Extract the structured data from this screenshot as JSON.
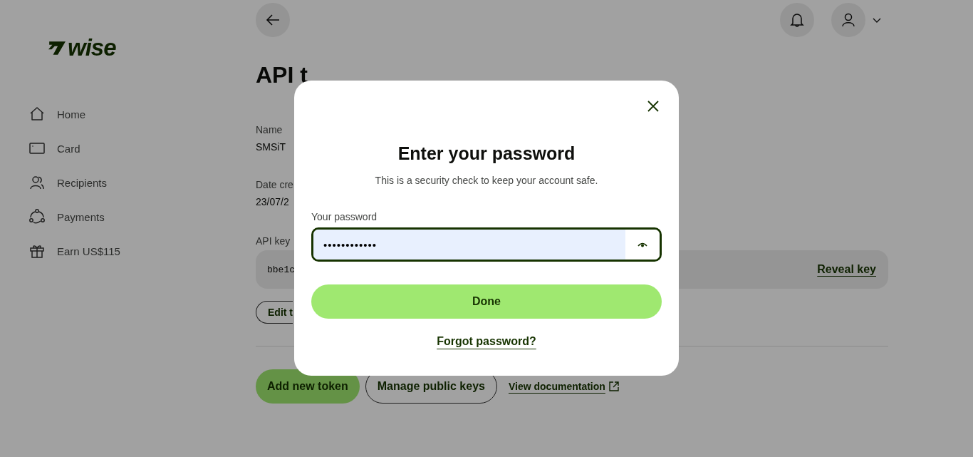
{
  "sidebar": {
    "logo": "wise",
    "nav": [
      {
        "label": "Home",
        "kind": "home"
      },
      {
        "label": "Card",
        "kind": "card"
      },
      {
        "label": "Recipients",
        "kind": "people"
      },
      {
        "label": "Payments",
        "kind": "payments"
      },
      {
        "label": "Earn US$115",
        "kind": "gift"
      }
    ]
  },
  "page": {
    "title": "API t",
    "fields": [
      {
        "label": "Name",
        "value": "SMSiT"
      },
      {
        "label": "Date cre",
        "value": "23/07/2"
      }
    ],
    "api_key": {
      "label": "API key",
      "value": "bbe1c",
      "action": "Reveal key"
    },
    "edit_button": "Edit t",
    "actions": [
      {
        "label": "Add new token",
        "kind": "primary"
      },
      {
        "label": "Manage public keys",
        "kind": "secondary"
      },
      {
        "label": "View documentation",
        "kind": "link"
      }
    ]
  },
  "modal": {
    "title": "Enter your password",
    "subtitle": "This is a security check to keep your account safe.",
    "field_label": "Your password",
    "value": "••••••••••••",
    "submit": "Done",
    "link": "Forgot password?"
  }
}
